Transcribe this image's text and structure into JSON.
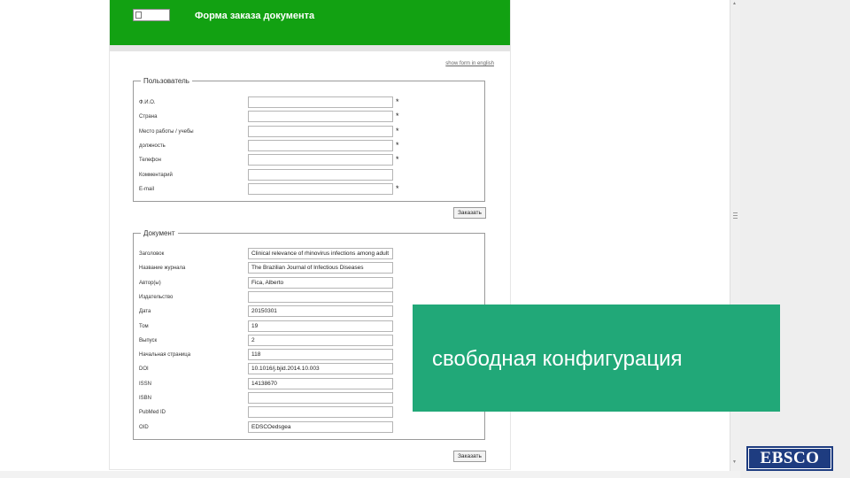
{
  "form": {
    "title": "Форма заказа документа",
    "lang_link": "show form in english",
    "required_mark": "*",
    "user_section": {
      "legend": "Пользователь",
      "fields": [
        {
          "label": "Ф.И.О.",
          "value": "",
          "required": true
        },
        {
          "label": "Страна",
          "value": "",
          "required": true
        },
        {
          "label": "Место работы / учебы",
          "value": "",
          "required": true
        },
        {
          "label": "должность",
          "value": "",
          "required": true
        },
        {
          "label": "Телефон",
          "value": "",
          "required": true
        },
        {
          "label": "Комментарий",
          "value": "",
          "required": false
        },
        {
          "label": "E-mail",
          "value": "",
          "required": true
        }
      ],
      "submit_label": "Заказать"
    },
    "document_section": {
      "legend": "Документ",
      "fields": [
        {
          "label": "Заголовок",
          "value": "Clinical relevance of rhinovirus infections among adult"
        },
        {
          "label": "Название журнала",
          "value": "The Brazilian Journal of Infectious Diseases"
        },
        {
          "label": "Автор(ы)",
          "value": "Fica, Alberto"
        },
        {
          "label": "Издательство",
          "value": ""
        },
        {
          "label": "Дата",
          "value": "20150301"
        },
        {
          "label": "Том",
          "value": "19"
        },
        {
          "label": "Выпуск",
          "value": "2"
        },
        {
          "label": "Начальная страница",
          "value": "118"
        },
        {
          "label": "DOI",
          "value": "10.1016/j.bjid.2014.10.003"
        },
        {
          "label": "ISSN",
          "value": "14138670"
        },
        {
          "label": "ISBN",
          "value": ""
        },
        {
          "label": "PubMed ID",
          "value": ""
        },
        {
          "label": "OID",
          "value": "EDSCOedsgea"
        }
      ],
      "submit_label": "Заказать"
    }
  },
  "overlay": {
    "text": "свободная конфигурация",
    "color": "#21a878"
  },
  "branding": {
    "logo_text": "EBSCO",
    "logo_color": "#1e3c80"
  },
  "colors": {
    "header_green": "#12a112"
  }
}
